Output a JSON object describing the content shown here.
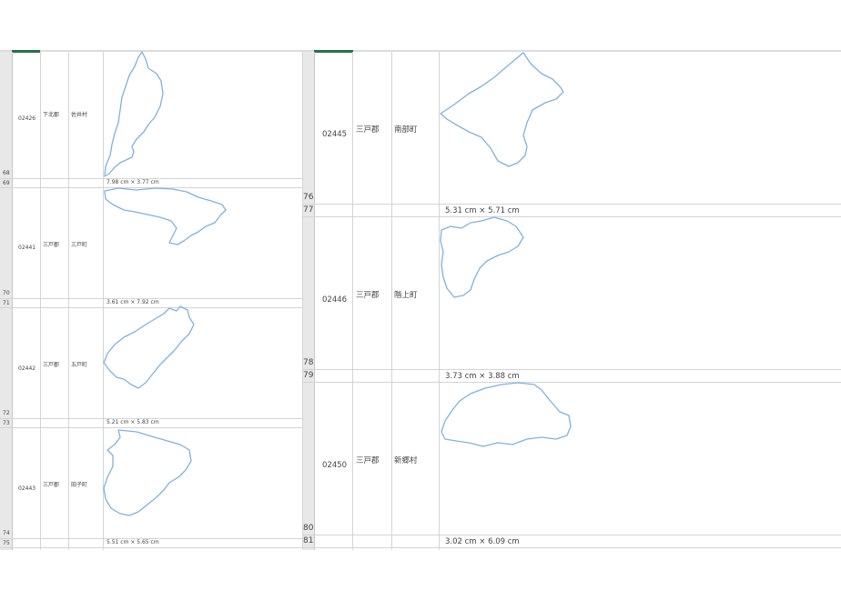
{
  "left": {
    "records": [
      {
        "code": "02426",
        "district": "下北郡",
        "town": "佐井村",
        "size": "7.98 cm × 3.77 cm",
        "row_a": "68",
        "row_b": "69"
      },
      {
        "code": "02441",
        "district": "三戸郡",
        "town": "三戸町",
        "size": "3.61 cm × 7.92 cm",
        "row_a": "70",
        "row_b": "71"
      },
      {
        "code": "02442",
        "district": "三戸郡",
        "town": "五戸町",
        "size": "5.21 cm × 5.83 cm",
        "row_a": "72",
        "row_b": "73"
      },
      {
        "code": "02443",
        "district": "三戸郡",
        "town": "田子町",
        "size": "5.51 cm × 5.65 cm",
        "row_a": "74",
        "row_b": "75"
      }
    ]
  },
  "right": {
    "records": [
      {
        "code": "02445",
        "district": "三戸郡",
        "town": "南部町",
        "size": "5.31 cm × 5.71 cm",
        "row_a": "76",
        "row_b": "77"
      },
      {
        "code": "02446",
        "district": "三戸郡",
        "town": "階上町",
        "size": "3.73 cm × 3.88 cm",
        "row_a": "78",
        "row_b": "79"
      },
      {
        "code": "02450",
        "district": "三戸郡",
        "town": "新郷村",
        "size": "3.02 cm × 6.09 cm",
        "row_a": "80",
        "row_b": "81"
      }
    ]
  },
  "colors": {
    "outline": "#7fb2dc",
    "grid": "#d4d4d4",
    "header_accent": "#217346",
    "row_header_bg": "#e8e8e8"
  }
}
